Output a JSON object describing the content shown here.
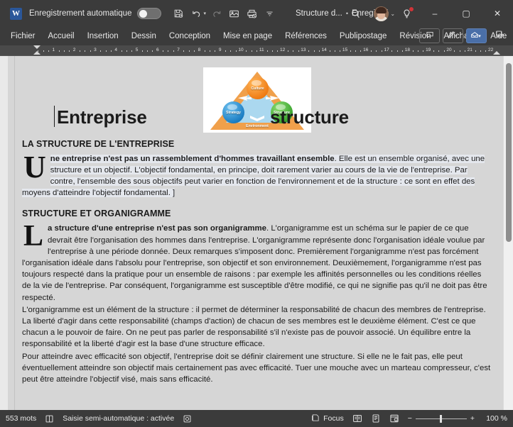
{
  "titlebar": {
    "app_icon": "word-logo",
    "autosave_label": "Enregistrement automatique",
    "autosave_state": "off",
    "qat": [
      {
        "name": "save-icon",
        "label": "Enregistrer"
      },
      {
        "name": "undo-icon",
        "label": "Annuler"
      },
      {
        "name": "redo-icon",
        "label": "Rétablir"
      },
      {
        "name": "touch-mode-icon",
        "label": "Mode tactile"
      },
      {
        "name": "print-preview-icon",
        "label": "Aperçu avant impression"
      },
      {
        "name": "customize-qat-icon",
        "label": "Personnaliser"
      }
    ],
    "document_name": "Structure d...",
    "saved_separator": "•",
    "saved_state": "Enregistré",
    "search_icon": "search-icon",
    "account_icon": "avatar",
    "tips_icon": "lightbulb-icon",
    "tips_badge": true,
    "minimize": "–",
    "maximize": "▢",
    "close": "✕"
  },
  "ribbon": {
    "tabs": [
      {
        "label": "Fichier",
        "active": false
      },
      {
        "label": "Accueil",
        "active": false
      },
      {
        "label": "Insertion",
        "active": false
      },
      {
        "label": "Dessin",
        "active": false
      },
      {
        "label": "Conception",
        "active": false
      },
      {
        "label": "Mise en page",
        "active": false
      },
      {
        "label": "Références",
        "active": false
      },
      {
        "label": "Publipostage",
        "active": false
      },
      {
        "label": "Révision",
        "active": false
      },
      {
        "label": "Affichage",
        "active": false
      },
      {
        "label": "Aide",
        "active": false
      }
    ],
    "right_buttons": [
      {
        "name": "comments-button",
        "icon": "comment-icon",
        "label": "Commentaires"
      },
      {
        "name": "editing-button",
        "icon": "pen-icon",
        "label": "Modification"
      },
      {
        "name": "share-button",
        "icon": "share-icon",
        "label": "Partager",
        "accent": true,
        "accent_color": "#4a6fa8"
      },
      {
        "name": "present-button",
        "icon": "presenter-icon",
        "label": "Présenter"
      }
    ]
  },
  "ruler": {
    "numbers": [
      1,
      2,
      3,
      4,
      5,
      6,
      7,
      8,
      9,
      10,
      11,
      12,
      13,
      14,
      15,
      16,
      17,
      18,
      19,
      20,
      21,
      22
    ],
    "left_indent_marker": "indent-marker",
    "right_indent_marker": "right-indent-marker"
  },
  "document": {
    "figure": {
      "name": "enterprise-triangle-diagram",
      "top_sphere": "Culture",
      "left_sphere": "Strategy",
      "right_sphere": "Structure",
      "base_label": "Environment",
      "triangle_color": "#f0a04b",
      "center_color": "#abd8ef",
      "culture_color": "#f07d16",
      "strategy_color": "#1d7fc4",
      "structure_color": "#3aa52e"
    },
    "title_left": "Entreprise",
    "title_right": "structure",
    "sections": [
      {
        "heading": "LA STRUCTURE DE L'ENTREPRISE",
        "dropcap": "U",
        "lead_bold": "ne entreprise n'est pas un rassemblement d'hommes travaillant ensemble",
        "lead_rest": ". Elle est un ensemble organisé, avec une structure et un objectif. L'objectif fondamental, en principe, doit rarement varier au cours de la vie de l'entreprise. Par contre, l'ensemble des sous objectifs peut varier en fonction de l'environnement et de la structure : ce sont en effet des moyens d'atteindre l'objectif fondamental. ]",
        "selected": true
      },
      {
        "heading": "STRUCTURE ET ORGANIGRAMME",
        "dropcap": "L",
        "lead_bold": "a structure d'une entreprise n'est pas son organigramme",
        "lead_rest": ". L'organigramme est un schéma sur le papier de ce que devrait être l'organisation des hommes dans l'entreprise. L'organigramme représente donc l'organisation idéale voulue par l'entreprise à une période donnée. Deux remarques s'imposent donc. Premièrement l'organigramme n'est pas forcément l'organisation idéale dans l'absolu pour l'entreprise, son objectif et son environnement. Deuxièmement, l'organigramme n'est pas toujours respecté dans la pratique pour un ensemble de raisons : par exemple les affinités personnelles ou les conditions réelles de la vie de l'entreprise. Par conséquent, l'organigramme est susceptible d'être modifié, ce qui ne signifie pas qu'il ne doit pas être respecté.",
        "selected": false
      }
    ],
    "paragraphs": [
      "L'organigramme est un élément de la structure : il permet de déterminer la responsabilité de chacun des membres de l'entreprise. La liberté d'agir dans cette responsabilité (champs d'action) de chacun de ses membres est le deuxième élément. C'est ce que chacun a le pouvoir de faire. On ne peut pas parler de responsabilité s'il n'existe pas de pouvoir associé. Un équilibre entre la responsabilité et la liberté d'agir est la base d'une structure efficace.",
      "Pour atteindre avec efficacité son objectif, l'entreprise doit se définir clairement une structure. Si elle ne le fait pas, elle peut éventuellement atteindre son objectif mais certainement pas avec efficacité. Tuer une mouche avec un marteau compresseur, c'est peut être atteindre l'objectif visé, mais sans efficacité."
    ]
  },
  "statusbar": {
    "word_count": "553 mots",
    "proofing_icon": "proofing-icon",
    "autocomplete_label": "Saisie semi-automatique : activée",
    "accessibility_icon": "accessibility-icon",
    "focus_label": "Focus",
    "focus_icon": "focus-icon",
    "view_read": "read-mode-icon",
    "view_print": "print-layout-icon",
    "view_web": "web-layout-icon",
    "zoom_out": "−",
    "zoom_in": "+",
    "zoom_value": "100 %"
  }
}
